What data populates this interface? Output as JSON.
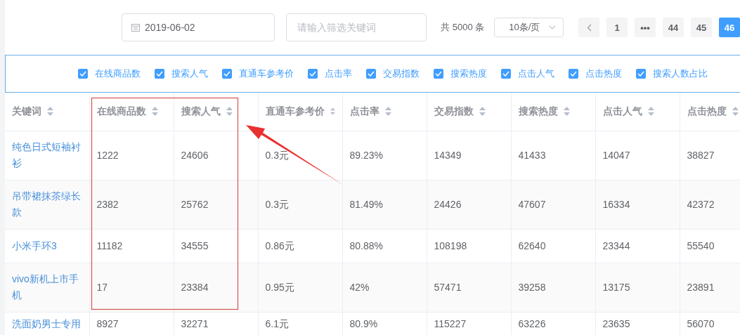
{
  "date_picker": {
    "value": "2019-06-02"
  },
  "keyword_filter": {
    "placeholder": "请输入筛选关键词"
  },
  "pagination": {
    "total": "共 5000 条",
    "page_size": "10条/页",
    "pages": [
      {
        "label": "1",
        "selected": false
      },
      {
        "label": "•••",
        "selected": false
      },
      {
        "label": "44",
        "selected": false
      },
      {
        "label": "45",
        "selected": false
      },
      {
        "label": "46",
        "selected": true
      }
    ]
  },
  "column_toggles": [
    {
      "label": "在线商品数",
      "checked": true
    },
    {
      "label": "搜索人气",
      "checked": true
    },
    {
      "label": "直通车参考价",
      "checked": true
    },
    {
      "label": "点击率",
      "checked": true
    },
    {
      "label": "交易指数",
      "checked": true
    },
    {
      "label": "搜索热度",
      "checked": true
    },
    {
      "label": "点击人气",
      "checked": true
    },
    {
      "label": "点击热度",
      "checked": true
    },
    {
      "label": "搜索人数占比",
      "checked": true
    }
  ],
  "table": {
    "columns": [
      "关键词",
      "在线商品数",
      "搜索人气",
      "直通车参考价",
      "点击率",
      "交易指数",
      "搜索热度",
      "点击人气",
      "点击热度"
    ],
    "rows": [
      [
        "纯色日式短袖衬衫",
        "1222",
        "24606",
        "0.3元",
        "89.23%",
        "14349",
        "41433",
        "14047",
        "38827"
      ],
      [
        "吊带裙抹茶绿长款",
        "2382",
        "25762",
        "0.3元",
        "81.49%",
        "24426",
        "47607",
        "16334",
        "42372"
      ],
      [
        "小米手环3",
        "11182",
        "34555",
        "0.86元",
        "80.88%",
        "108198",
        "62640",
        "23344",
        "55540"
      ],
      [
        "vivo新机上市手机",
        "17",
        "23384",
        "0.95元",
        "42%",
        "57471",
        "39258",
        "13175",
        "23891"
      ],
      [
        "洗面奶男士专用",
        "8927",
        "32271",
        "6.1元",
        "80.9%",
        "115227",
        "63226",
        "23635",
        "56070"
      ]
    ]
  }
}
